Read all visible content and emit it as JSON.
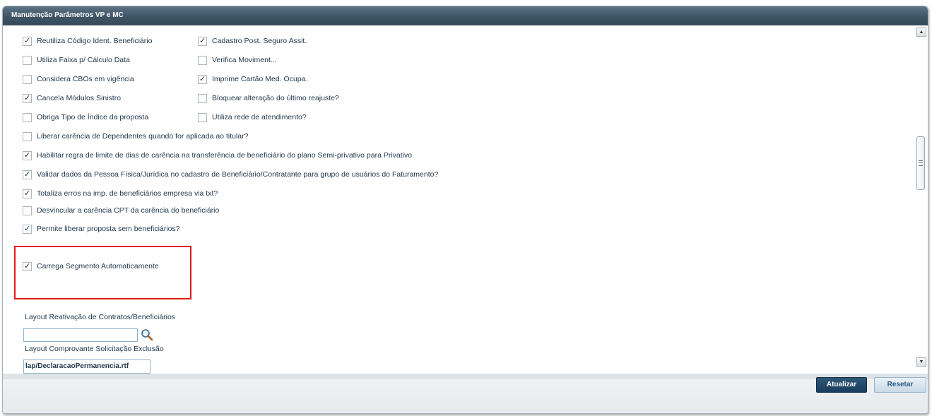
{
  "window": {
    "title": "Manutenção Parâmetros VP e MC"
  },
  "checkboxes": [
    {
      "label": "Reutiliza Código Ident. Beneficiário",
      "checked": true
    },
    {
      "label": "Cadastro Post. Seguro Assit.",
      "checked": true
    },
    {
      "label": "Utiliza Faixa p/ Cálculo Data",
      "checked": false
    },
    {
      "label": "Verifica Moviment...",
      "checked": false
    },
    {
      "label": "Considera CBOs em vigência",
      "checked": false
    },
    {
      "label": "Imprime Cartão Med. Ocupa.",
      "checked": true
    },
    {
      "label": "Cancela Módulos Sinistro",
      "checked": true
    },
    {
      "label": "Bloquear alteração do último reajuste?",
      "checked": false
    },
    {
      "label": "Obriga Tipo de Índice da proposta",
      "checked": false
    },
    {
      "label": "Utiliza rede de atendimento?",
      "checked": false
    },
    {
      "label": "Liberar carência de Dependentes quando for aplicada ao titular?",
      "checked": false
    },
    {
      "label": "Habilitar regra de limite de dias de carência na transferência de beneficiário do plano Semi-privativo para Privativo",
      "checked": true
    },
    {
      "label": "Validar dados da Pessoa Física/Jurídica no cadastro de Beneficiário/Contratante para grupo de usuários do Faturamento?",
      "checked": true
    },
    {
      "label": "Totaliza erros na imp. de beneficiários empresa via txt?",
      "checked": true
    },
    {
      "label": "Desvincular a carência CPT da carência do beneficiário",
      "checked": false
    },
    {
      "label": "Permite liberar proposta sem beneficiários?",
      "checked": true
    },
    {
      "label": "Carrega Segmento Automaticamente",
      "checked": true
    }
  ],
  "fields": {
    "layout_reativacao": {
      "label": "Layout Reativação de Contratos/Beneficiários",
      "value": ""
    },
    "layout_comprovante": {
      "label": "Layout Comprovante Solicitação Exclusão",
      "value": "lap/DeclaracaoPermanencia.rtf"
    }
  },
  "scrollbar": {
    "up": "▲",
    "down": "▼"
  },
  "buttons": {
    "update": "Atualizar",
    "reset": "Resetar"
  }
}
